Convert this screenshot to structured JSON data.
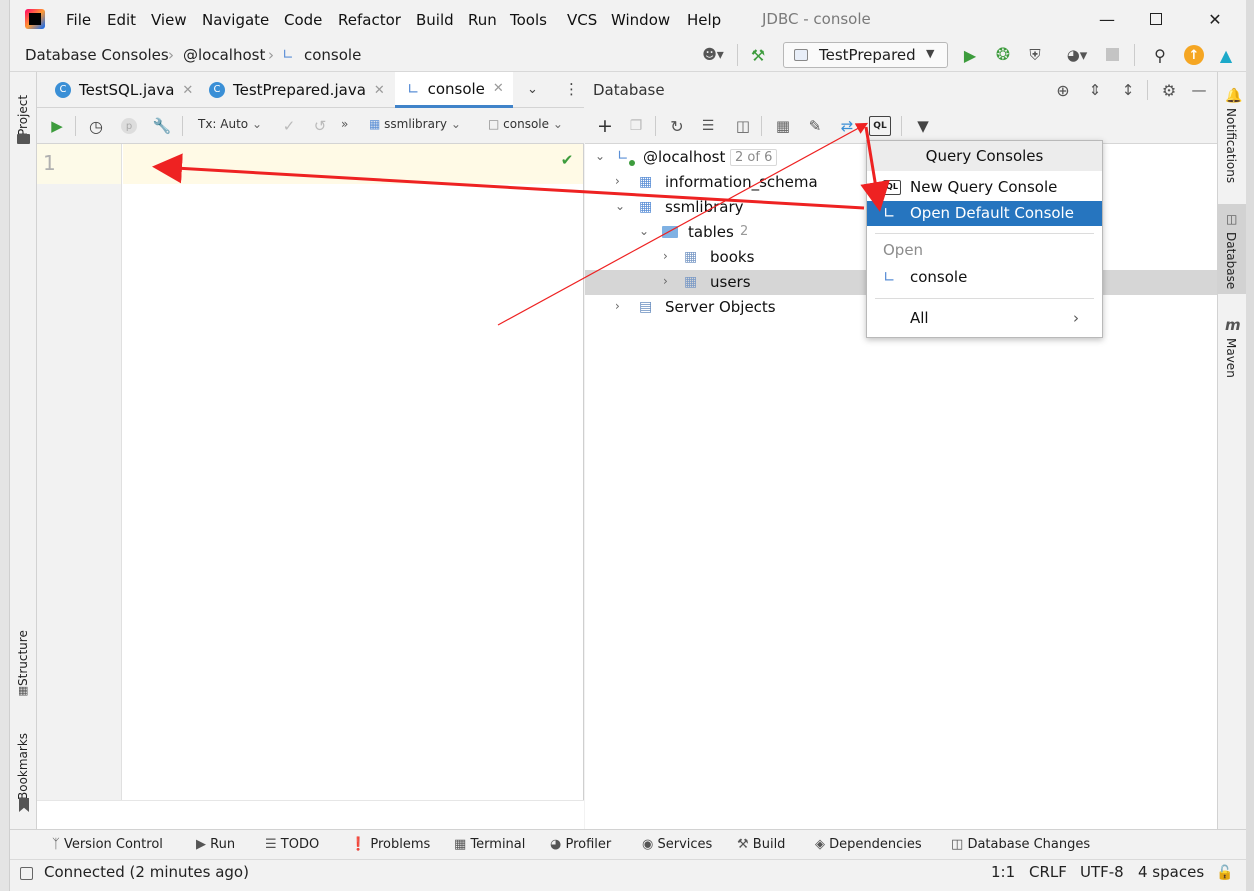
{
  "window": {
    "title": "JDBC - console"
  },
  "menu": [
    "File",
    "Edit",
    "View",
    "Navigate",
    "Code",
    "Refactor",
    "Build",
    "Run",
    "Tools",
    "VCS",
    "Window",
    "Help"
  ],
  "breadcrumb": [
    "Database Consoles",
    "@localhost",
    "console"
  ],
  "run_config": "TestPrepared",
  "editor_tabs": [
    {
      "label": "TestSQL.java"
    },
    {
      "label": "TestPrepared.java"
    },
    {
      "label": "console",
      "active": true
    }
  ],
  "editor_toolbar": {
    "tx": "Tx: Auto",
    "schema": "ssmlibrary",
    "session": "console"
  },
  "editor": {
    "line_number": "1"
  },
  "left_tools": {
    "project": "Project",
    "structure": "Structure",
    "bookmarks": "Bookmarks"
  },
  "right_tools": {
    "notifications": "Notifications",
    "database": "Database",
    "maven": "Maven"
  },
  "db_panel": {
    "title": "Database",
    "tree": [
      {
        "label": "@localhost",
        "badge": "2 of 6"
      },
      {
        "label": "information_schema"
      },
      {
        "label": "ssmlibrary"
      },
      {
        "label": "tables",
        "count": "2"
      },
      {
        "label": "books"
      },
      {
        "label": "users",
        "selected": true
      },
      {
        "label": "Server Objects"
      }
    ]
  },
  "popup": {
    "title": "Query Consoles",
    "items": [
      "New Query Console",
      "Open Default Console"
    ],
    "open_group": "Open",
    "open_items": [
      "console"
    ],
    "all": "All"
  },
  "bottom_tools": [
    "Version Control",
    "Run",
    "TODO",
    "Problems",
    "Terminal",
    "Profiler",
    "Services",
    "Build",
    "Dependencies",
    "Database Changes"
  ],
  "status": {
    "message": "Connected (2 minutes ago)",
    "position": "1:1",
    "line_sep": "CRLF",
    "encoding": "UTF-8",
    "indent": "4 spaces"
  },
  "colors": {
    "selection": "#2675bf",
    "annotation_arrow": "#ee2222",
    "run_green": "#3d9c3d",
    "editor_line": "#fffae6"
  }
}
